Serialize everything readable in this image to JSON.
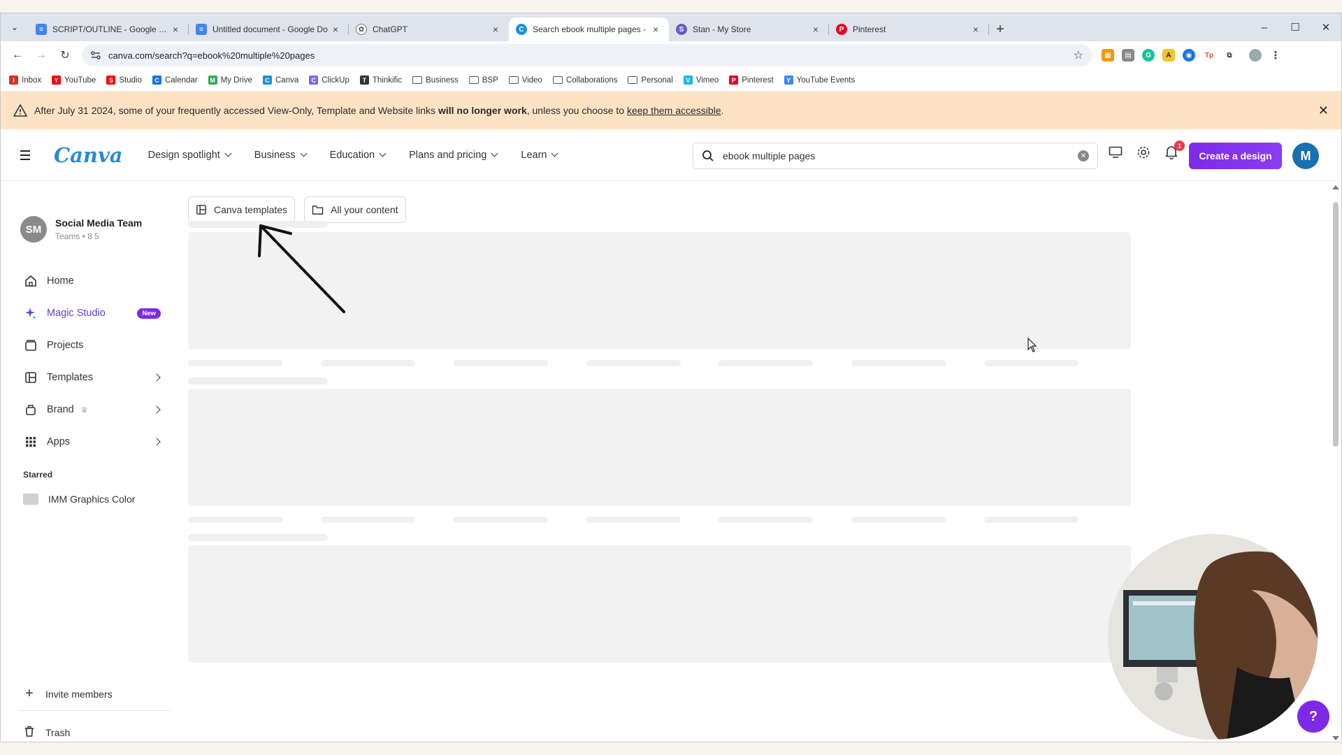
{
  "browser": {
    "tabs": [
      {
        "title": "SCRIPT/OUTLINE - Google Doc",
        "icon": "google-docs-icon",
        "color": "#4285f4"
      },
      {
        "title": "Untitled document - Google Do",
        "icon": "google-docs-icon",
        "color": "#4285f4"
      },
      {
        "title": "ChatGPT",
        "icon": "chatgpt-icon",
        "color": "#555555"
      },
      {
        "title": "Search ebook multiple pages -",
        "icon": "canva-icon",
        "color": "#1b8fd8"
      },
      {
        "title": "Stan - My Store",
        "icon": "stan-icon",
        "color": "#6a5acd"
      },
      {
        "title": "Pinterest",
        "icon": "pinterest-icon",
        "color": "#e60023"
      }
    ],
    "url": "canva.com/search?q=ebook%20multiple%20pages",
    "bookmarks": [
      {
        "label": "Inbox",
        "icon": "gmail-icon",
        "color": "#d93025"
      },
      {
        "label": "YouTube",
        "icon": "youtube-icon",
        "color": "#ff0000"
      },
      {
        "label": "Studio",
        "icon": "youtube-studio-icon",
        "color": "#ff0000"
      },
      {
        "label": "Calendar",
        "icon": "calendar-icon",
        "color": "#1a73e8"
      },
      {
        "label": "My Drive",
        "icon": "drive-icon",
        "color": "#34a853"
      },
      {
        "label": "Canva",
        "icon": "canva-icon",
        "color": "#1b8fd8"
      },
      {
        "label": "ClickUp",
        "icon": "clickup-icon",
        "color": "#7b68ee"
      },
      {
        "label": "Thinkific",
        "icon": "thinkific-icon",
        "color": "#333333"
      },
      {
        "label": "Business",
        "icon": "folder-icon"
      },
      {
        "label": "BSP",
        "icon": "folder-icon"
      },
      {
        "label": "Video",
        "icon": "folder-icon"
      },
      {
        "label": "Collaborations",
        "icon": "folder-icon"
      },
      {
        "label": "Personal",
        "icon": "folder-icon"
      },
      {
        "label": "Vimeo",
        "icon": "vimeo-icon",
        "color": "#1ab7ea"
      },
      {
        "label": "Pinterest",
        "icon": "pinterest-icon",
        "color": "#e60023"
      },
      {
        "label": "YouTube Events",
        "icon": "google-icon",
        "color": "#4285f4"
      }
    ]
  },
  "banner": {
    "text_before": "After July 31 2024, some of your frequently accessed View-Only, Template and Website links ",
    "text_bold": "will no longer work",
    "text_middle": ", unless you choose to ",
    "link": "keep them accessible",
    "text_end": "."
  },
  "header": {
    "logo": "Canva",
    "nav": [
      "Design spotlight",
      "Business",
      "Education",
      "Plans and pricing",
      "Learn"
    ],
    "search_value": "ebook multiple pages",
    "notification_count": "1",
    "create_label": "Create a design",
    "avatar_initial": "M",
    "brand_color": "#7d2ae8"
  },
  "sidebar": {
    "team_initials": "SM",
    "team_name": "Social Media Team",
    "team_meta": "Teams • 8 5",
    "items": [
      {
        "label": "Home",
        "icon": "home-icon"
      },
      {
        "label": "Magic Studio",
        "icon": "sparkle-icon",
        "badge": "New"
      },
      {
        "label": "Projects",
        "icon": "projects-icon"
      },
      {
        "label": "Templates",
        "icon": "templates-icon"
      },
      {
        "label": "Brand",
        "icon": "brand-icon"
      },
      {
        "label": "Apps",
        "icon": "apps-grid-icon"
      }
    ],
    "starred_label": "Starred",
    "starred_item": "IMM Graphics Color",
    "invite_label": "Invite members",
    "trash_label": "Trash"
  },
  "main": {
    "filters": [
      "Canva templates",
      "All your content"
    ]
  }
}
